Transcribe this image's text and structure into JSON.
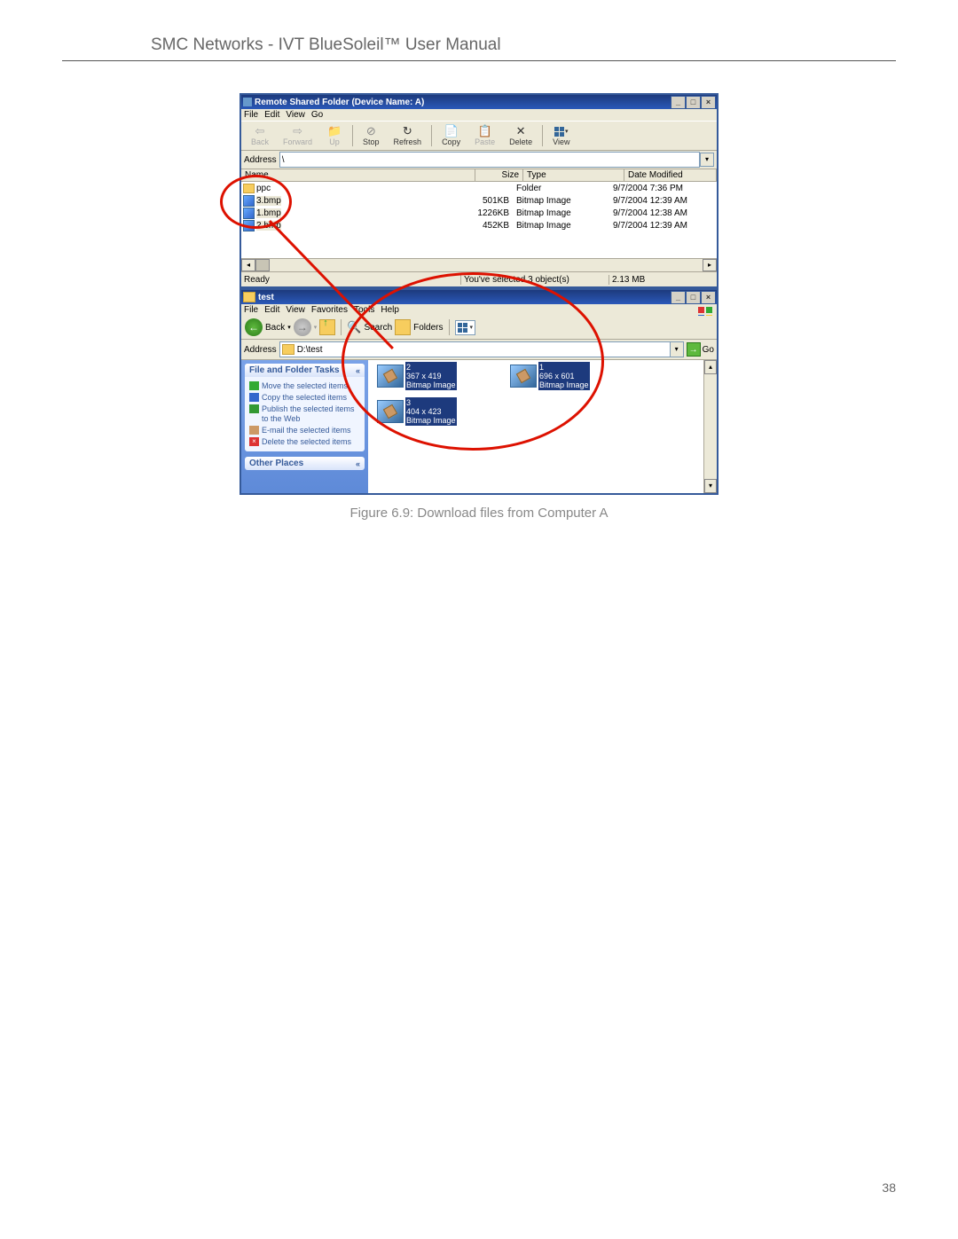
{
  "doc": {
    "header_title": "SMC Networks - IVT BlueSoleil™ User Manual",
    "caption": "Figure 6.9: Download files from Computer A",
    "page_number": "38"
  },
  "window1": {
    "title": "Remote Shared Folder (Device Name: A)",
    "menu": [
      "File",
      "Edit",
      "View",
      "Go"
    ],
    "toolbar": {
      "back": "Back",
      "forward": "Forward",
      "up": "Up",
      "stop": "Stop",
      "refresh": "Refresh",
      "copy": "Copy",
      "paste": "Paste",
      "delete": "Delete",
      "view": "View"
    },
    "address_label": "Address",
    "address_value": "\\",
    "columns": {
      "name": "Name",
      "size": "Size",
      "type": "Type",
      "date": "Date Modified"
    },
    "rows": [
      {
        "name": "ppc",
        "size": "",
        "type": "Folder",
        "date": "9/7/2004 7:36 PM",
        "kind": "folder"
      },
      {
        "name": "3.bmp",
        "size": "501KB",
        "type": "Bitmap Image",
        "date": "9/7/2004 12:39 AM",
        "kind": "bmp",
        "sel": true
      },
      {
        "name": "1.bmp",
        "size": "1226KB",
        "type": "Bitmap Image",
        "date": "9/7/2004 12:38 AM",
        "kind": "bmp",
        "sel": true
      },
      {
        "name": "2.bmp",
        "size": "452KB",
        "type": "Bitmap Image",
        "date": "9/7/2004 12:39 AM",
        "kind": "bmp",
        "sel": true
      }
    ],
    "status": {
      "ready": "Ready",
      "selection": "You've selected 3 object(s)",
      "size": "2.13 MB"
    }
  },
  "window2": {
    "title": "test",
    "menu": [
      "File",
      "Edit",
      "View",
      "Favorites",
      "Tools",
      "Help"
    ],
    "toolbar": {
      "back": "Back",
      "search": "Search",
      "folders": "Folders"
    },
    "address_label": "Address",
    "address_value": "D:\\test",
    "go_label": "Go",
    "tasks": {
      "header": "File and Folder Tasks",
      "items": [
        "Move the selected items",
        "Copy the selected items",
        "Publish the selected items to the Web",
        "E-mail the selected items",
        "Delete the selected items"
      ],
      "other_header": "Other Places"
    },
    "thumbs": [
      {
        "n": "2",
        "dim": "367 x 419",
        "type": "Bitmap Image"
      },
      {
        "n": "1",
        "dim": "696 x 601",
        "type": "Bitmap Image"
      },
      {
        "n": "3",
        "dim": "404 x 423",
        "type": "Bitmap Image"
      }
    ]
  },
  "col": {
    "chev": "«"
  }
}
